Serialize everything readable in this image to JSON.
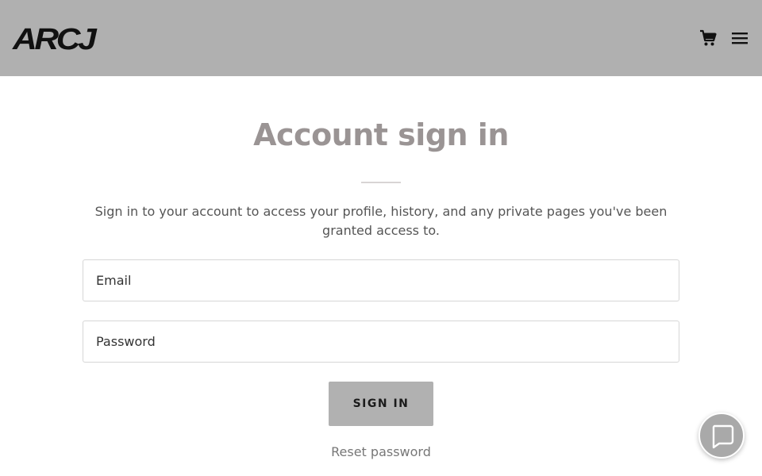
{
  "header": {
    "logo_text": "ARCJ",
    "background_color": "#b0b0b0",
    "cart_icon": "shopping-cart-icon",
    "menu_icon": "hamburger-menu-icon"
  },
  "main": {
    "title": "Account sign in",
    "description": "Sign in to your account to access your profile, history, and any private pages you've been granted access to.",
    "email_placeholder": "Email",
    "password_placeholder": "Password",
    "signin_label": "SIGN IN",
    "reset_label": "Reset password",
    "button_color": "#b1b1b1"
  },
  "chat": {
    "icon": "chat-bubble-icon"
  }
}
